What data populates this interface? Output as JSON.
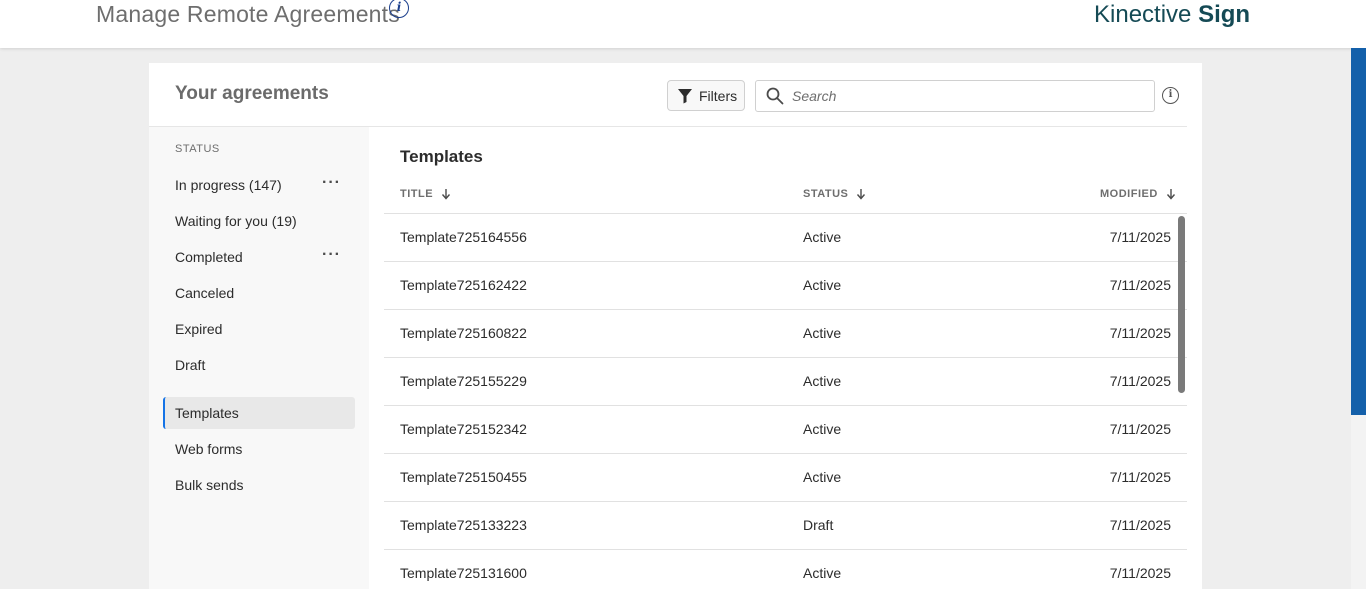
{
  "header": {
    "page_title": "Manage Remote Agreements",
    "info_symbol": "i",
    "brand_regular": "Kinective",
    "brand_bold": "Sign"
  },
  "panel": {
    "title": "Your agreements",
    "filters_label": "Filters",
    "search_placeholder": "Search",
    "info_symbol": "i"
  },
  "sidebar": {
    "section_label": "STATUS",
    "items": [
      {
        "label": "In progress (147)",
        "has_more": true
      },
      {
        "label": "Waiting for you (19)",
        "has_more": false
      },
      {
        "label": "Completed",
        "has_more": true
      },
      {
        "label": "Canceled",
        "has_more": false
      },
      {
        "label": "Expired",
        "has_more": false
      },
      {
        "label": "Draft",
        "has_more": false
      },
      {
        "label": "Templates",
        "has_more": false,
        "selected": true
      },
      {
        "label": "Web forms",
        "has_more": false
      },
      {
        "label": "Bulk sends",
        "has_more": false
      }
    ],
    "more_symbol": "···"
  },
  "list": {
    "title": "Templates",
    "columns": {
      "title": "TITLE",
      "status": "STATUS",
      "modified": "MODIFIED"
    },
    "rows": [
      {
        "title": "Template725164556",
        "status": "Active",
        "modified": "7/11/2025"
      },
      {
        "title": "Template725162422",
        "status": "Active",
        "modified": "7/11/2025"
      },
      {
        "title": "Template725160822",
        "status": "Active",
        "modified": "7/11/2025"
      },
      {
        "title": "Template725155229",
        "status": "Active",
        "modified": "7/11/2025"
      },
      {
        "title": "Template725152342",
        "status": "Active",
        "modified": "7/11/2025"
      },
      {
        "title": "Template725150455",
        "status": "Active",
        "modified": "7/11/2025"
      },
      {
        "title": "Template725133223",
        "status": "Draft",
        "modified": "7/11/2025"
      },
      {
        "title": "Template725131600",
        "status": "Active",
        "modified": "7/11/2025"
      }
    ]
  },
  "colors": {
    "brand_text": "#154a55",
    "accent_blue": "#1460aa",
    "selected_border": "#1473e6"
  },
  "icons": {
    "filter": "filter-funnel-icon",
    "search": "magnifier-search-icon",
    "info": "info-circle-icon",
    "sort": "arrow-down-sort-icon",
    "more": "ellipsis-more-icon"
  }
}
